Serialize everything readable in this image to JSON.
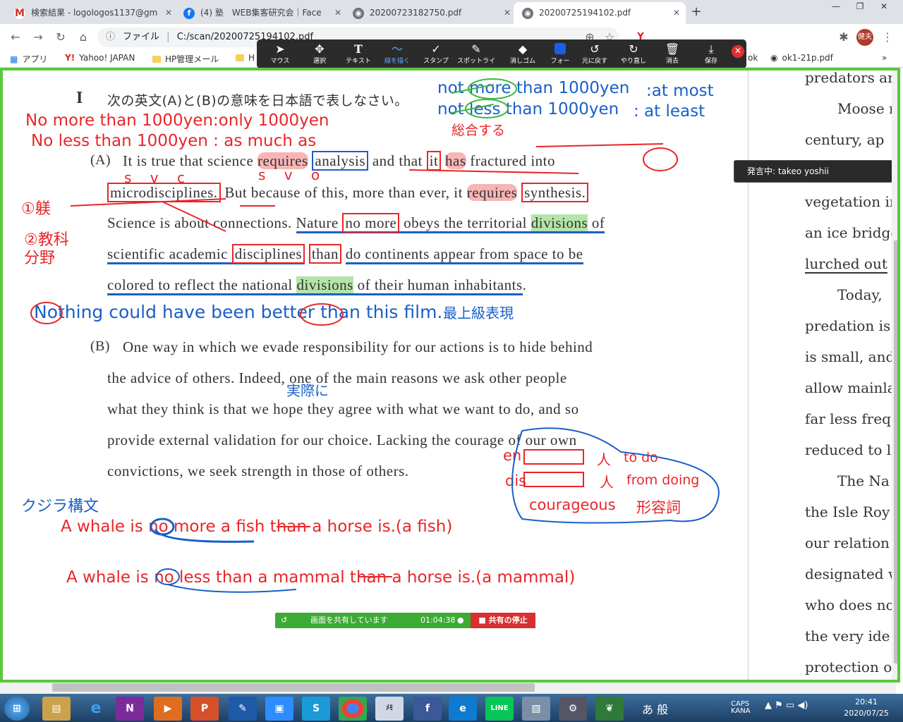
{
  "tabs": [
    {
      "label": "検索結果 - logologos1137@gm",
      "icon": "gmail-icon"
    },
    {
      "label": "(4) 塾　WEB集客研究会｜Face",
      "icon": "facebook-icon"
    },
    {
      "label": "20200723182750.pdf",
      "icon": "globe-icon"
    },
    {
      "label": "20200725194102.pdf",
      "icon": "globe-icon"
    }
  ],
  "address": {
    "scheme": "ファイル",
    "path": "C:/scan/20200725194102.pdf"
  },
  "profile_initials": "健夫",
  "bookmarks": [
    "アプリ",
    "Yahoo! JAPAN",
    "HP管理メール",
    "H",
    "ok",
    "ok1-21p.pdf"
  ],
  "toolbar": {
    "items": [
      {
        "label": "マウス",
        "icon": "cursor-icon"
      },
      {
        "label": "選択",
        "icon": "move-icon"
      },
      {
        "label": "テキスト",
        "icon": "text-icon"
      },
      {
        "label": "線を描く",
        "icon": "draw-line-icon"
      },
      {
        "label": "スタンプ",
        "icon": "stamp-icon"
      },
      {
        "label": "スポットライ",
        "icon": "spotlight-icon"
      },
      {
        "label": "消しゴム",
        "icon": "eraser-icon"
      },
      {
        "label": "フォー",
        "icon": "format-icon"
      },
      {
        "label": "元に戻す",
        "icon": "undo-icon"
      },
      {
        "label": "やり直し",
        "icon": "redo-icon"
      },
      {
        "label": "消去",
        "icon": "clear-icon"
      },
      {
        "label": "保存",
        "icon": "save-icon"
      }
    ]
  },
  "speaker": "発言中: takeo yoshii",
  "share": {
    "status": "画面を共有しています",
    "time": "01:04:38",
    "stop": "共有の停止"
  },
  "document": {
    "section_num": "I",
    "heading": "次の英文(A)と(B)の意味を日本語で表しなさい。",
    "a_label": "(A)",
    "a_lines": [
      "It is true that science requires analysis and that it has fractured into",
      "microdisciplines. But because of this, more than ever, it requires synthesis.",
      "Science is about connections.  Nature no more obeys the territorial divisions of",
      "scientific academic disciplines than do continents appear from space to be",
      "colored to reflect the national divisions of their human inhabitants."
    ],
    "b_label": "(B)",
    "b_lines": [
      "One way in which we evade responsibility for our actions is to hide behind",
      "the advice of others. Indeed, one of the main reasons we ask other people",
      "what they think is that we hope they agree with what we want to do, and so",
      "provide external validation for our choice. Lacking the courage of our own",
      "convictions, we seek strength in those of others."
    ]
  },
  "annotations": {
    "not_more": "not more than 1000yen",
    "at_most": ":at most",
    "not_less": "not less than 1000yen",
    "at_least": ":  at least",
    "sougou": "総合する",
    "no_more": "No more than 1000yen:only 1000yen",
    "no_less": "No less than 1000yen  :  as much as",
    "marker1": "①躾",
    "marker2a": "②教科",
    "marker2b": "分野",
    "nothing": "Nothing could have been better than this film.",
    "superlative": "最上級表現",
    "jissai": "実際に",
    "en": "en",
    "dis": "dis",
    "hito1": "人",
    "hito2": "人",
    "to_do": "to do",
    "from_doing": "from doing",
    "courageous": "courageous",
    "keiyoushi": "形容詞",
    "kujira": "クジラ構文",
    "whale1": "A whale is no more a fish than a horse is.(a fish)",
    "whale2": "A whale is no less than a mammal than a horse is.(a mammal)",
    "svc1": "s  v   c",
    "svo": "s    v     o"
  },
  "right_page_lines": [
    "predators ar",
    "Moose r",
    "century,  ap",
    "",
    "vegetation in",
    "an ice bridge",
    "lurched out",
    "Today,",
    "predation is",
    "is small, and",
    "allow mainla",
    "far less freq",
    "reduced to li",
    "The Na",
    "the Isle Roy",
    "our  relation",
    "designated w",
    "who does no",
    "the very ide",
    "protection of"
  ],
  "taskbar": {
    "time": "20:41",
    "date": "2020/07/25",
    "ime": "あ 般"
  }
}
